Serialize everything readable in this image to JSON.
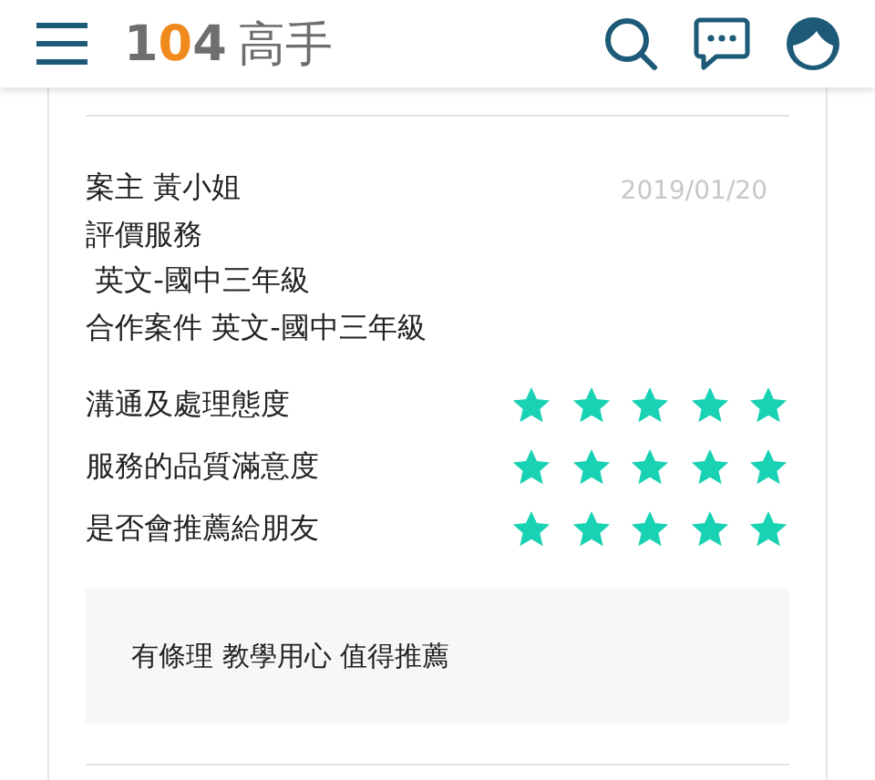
{
  "header": {
    "logo": {
      "number": "104",
      "name": "高手"
    }
  },
  "review": {
    "client": "案主 黃小姐",
    "date": "2019/01/20",
    "service_label": "評價服務",
    "service": " 英文-國中三年級",
    "case": "合作案件 英文-國中三年級",
    "ratings": [
      {
        "label": "溝通及處理態度",
        "stars": 5
      },
      {
        "label": "服務的品質滿意度",
        "stars": 5
      },
      {
        "label": "是否會推薦給朋友",
        "stars": 5
      }
    ],
    "comment": "有條理 教學用心 值得推薦"
  }
}
